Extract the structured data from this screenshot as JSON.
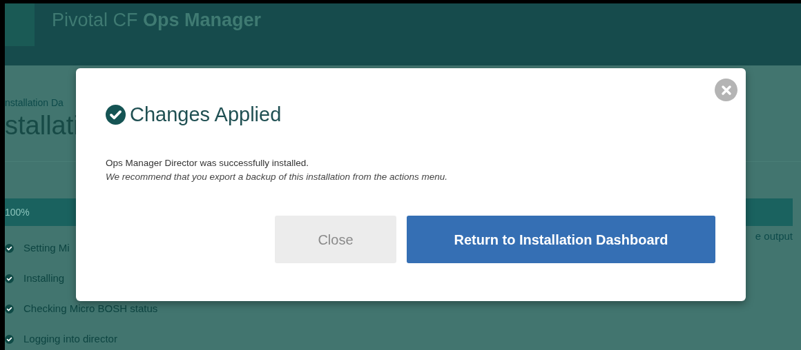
{
  "header": {
    "title_light": "Pivotal CF",
    "title_bold": "Ops Manager"
  },
  "breadcrumb": "nstallation Da",
  "page_title": "stallati",
  "progress": {
    "label": "100%",
    "level": 1
  },
  "output_link": "e output",
  "steps": [
    {
      "label": "Setting Mi"
    },
    {
      "label": "Installing"
    },
    {
      "label": "Checking Micro BOSH status"
    },
    {
      "label": "Logging into director"
    }
  ],
  "dialog": {
    "title": "Changes Applied",
    "message": "Ops Manager Director was successfully installed.",
    "note": "We recommend that you export a backup of this installation from the actions menu.",
    "buttons": [
      {
        "label": "Close",
        "kind": "secondary",
        "disabled": true
      },
      {
        "label": "Return to Installation Dashboard",
        "kind": "primary",
        "disabled": false
      }
    ]
  }
}
